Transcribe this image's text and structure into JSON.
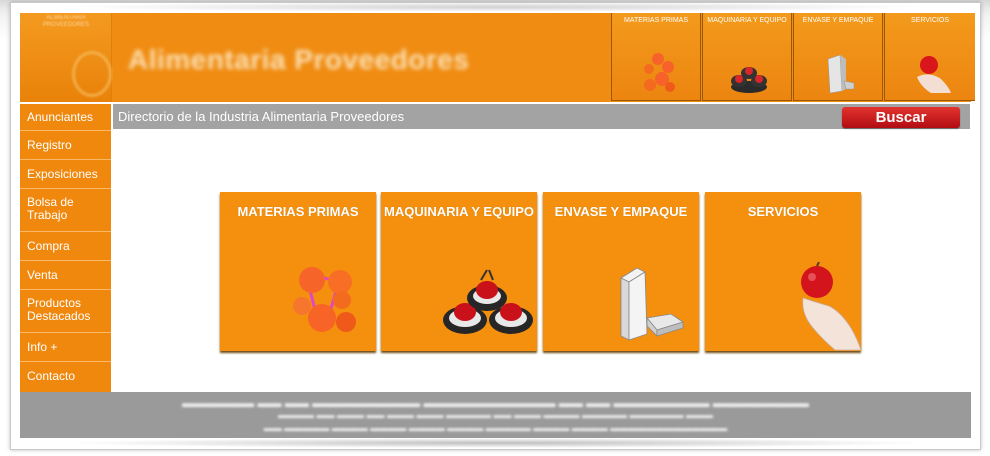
{
  "header": {
    "logo_text": "ALIMENTARIA PROVEEDORES",
    "brand_title": "Alimentaria Proveedores",
    "tabs": [
      {
        "label": "MATERIAS PRIMAS",
        "icon": "orange-molecule-icon"
      },
      {
        "label": "MAQUINARIA Y EQUIPO",
        "icon": "machinery-icon"
      },
      {
        "label": "ENVASE Y EMPAQUE",
        "icon": "carton-pack-icon"
      },
      {
        "label": "SERVICIOS",
        "icon": "apple-hand-icon"
      }
    ]
  },
  "sidebar": {
    "items": [
      {
        "label": "Anunciantes"
      },
      {
        "label": "Registro"
      },
      {
        "label": "Exposiciones"
      },
      {
        "label": "Bolsa de Trabajo"
      },
      {
        "label": "Compra"
      },
      {
        "label": "Venta"
      },
      {
        "label": "Productos Destacados"
      },
      {
        "label": "Info +"
      },
      {
        "label": "Contacto"
      }
    ]
  },
  "subbar": {
    "title": "Directorio de la Industria Alimentaria Proveedores",
    "search_button": "Buscar"
  },
  "categories": [
    {
      "label": "MATERIAS PRIMAS",
      "icon": "orange-molecule-icon"
    },
    {
      "label": "MAQUINARIA Y EQUIPO",
      "icon": "machinery-icon"
    },
    {
      "label": "ENVASE Y EMPAQUE",
      "icon": "carton-pack-icon"
    },
    {
      "label": "SERVICIOS",
      "icon": "apple-hand-icon"
    }
  ],
  "colors": {
    "accent": "#f08c12",
    "search_button": "#c81d20",
    "subbar": "#a3a3a3",
    "footer": "#9a9a9a"
  }
}
